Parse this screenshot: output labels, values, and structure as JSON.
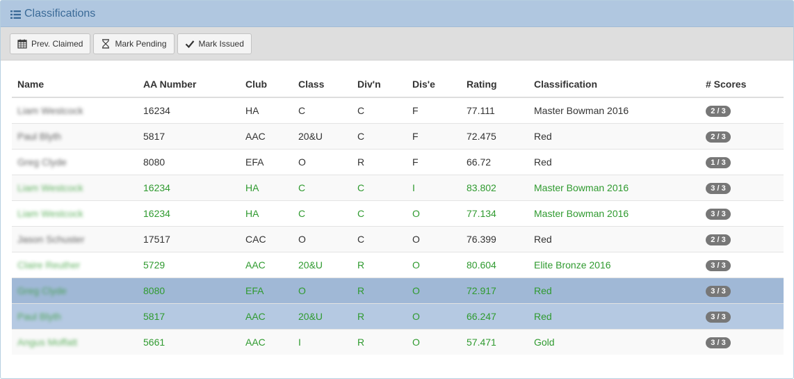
{
  "panel": {
    "title": "Classifications",
    "title_icon": "list-icon"
  },
  "toolbar": {
    "buttons": [
      {
        "label": "Prev. Claimed",
        "icon": "calendar-icon"
      },
      {
        "label": "Mark Pending",
        "icon": "hourglass-icon"
      },
      {
        "label": "Mark Issued",
        "icon": "checkmark-icon"
      }
    ]
  },
  "table": {
    "headers": [
      "Name",
      "AA Number",
      "Club",
      "Class",
      "Div'n",
      "Dis'e",
      "Rating",
      "Classification",
      "# Scores"
    ],
    "rows": [
      {
        "name": "Liam Westcock",
        "aa_number": "16234",
        "club": "HA",
        "class": "C",
        "divn": "C",
        "dise": "F",
        "rating": "77.111",
        "classification": "Master Bowman 2016",
        "scores": "2 / 3",
        "style": "normal"
      },
      {
        "name": "Paul Blyth",
        "aa_number": "5817",
        "club": "AAC",
        "class": "20&U",
        "divn": "C",
        "dise": "F",
        "rating": "72.475",
        "classification": "Red",
        "scores": "2 / 3",
        "style": "alt"
      },
      {
        "name": "Greg Clyde",
        "aa_number": "8080",
        "club": "EFA",
        "class": "O",
        "divn": "R",
        "dise": "F",
        "rating": "66.72",
        "classification": "Red",
        "scores": "1 / 3",
        "style": "normal"
      },
      {
        "name": "Liam Westcock",
        "aa_number": "16234",
        "club": "HA",
        "class": "C",
        "divn": "C",
        "dise": "I",
        "rating": "83.802",
        "classification": "Master Bowman 2016",
        "scores": "3 / 3",
        "style": "green-alt"
      },
      {
        "name": "Liam Westcock",
        "aa_number": "16234",
        "club": "HA",
        "class": "C",
        "divn": "C",
        "dise": "O",
        "rating": "77.134",
        "classification": "Master Bowman 2016",
        "scores": "3 / 3",
        "style": "green"
      },
      {
        "name": "Jason Schuster",
        "aa_number": "17517",
        "club": "CAC",
        "class": "O",
        "divn": "C",
        "dise": "O",
        "rating": "76.399",
        "classification": "Red",
        "scores": "2 / 3",
        "style": "alt"
      },
      {
        "name": "Claire Reuther",
        "aa_number": "5729",
        "club": "AAC",
        "class": "20&U",
        "divn": "R",
        "dise": "O",
        "rating": "80.604",
        "classification": "Elite Bronze 2016",
        "scores": "3 / 3",
        "style": "green"
      },
      {
        "name": "Greg Clyde",
        "aa_number": "8080",
        "club": "EFA",
        "class": "O",
        "divn": "R",
        "dise": "O",
        "rating": "72.917",
        "classification": "Red",
        "scores": "3 / 3",
        "style": "green-sel-dark"
      },
      {
        "name": "Paul Blyth",
        "aa_number": "5817",
        "club": "AAC",
        "class": "20&U",
        "divn": "R",
        "dise": "O",
        "rating": "66.247",
        "classification": "Red",
        "scores": "3 / 3",
        "style": "green-sel-light"
      },
      {
        "name": "Angus Moffatt",
        "aa_number": "5661",
        "club": "AAC",
        "class": "I",
        "divn": "R",
        "dise": "O",
        "rating": "57.471",
        "classification": "Gold",
        "scores": "3 / 3",
        "style": "green-last"
      }
    ]
  },
  "colors": {
    "heading_bg": "#b0c7e0",
    "heading_text": "#3a6a97",
    "toolbar_bg": "#dedede",
    "green_text": "#2f9a2f",
    "selected_dark": "#a0b8d6",
    "selected_light": "#b5c9e2",
    "badge_bg": "#777777"
  }
}
